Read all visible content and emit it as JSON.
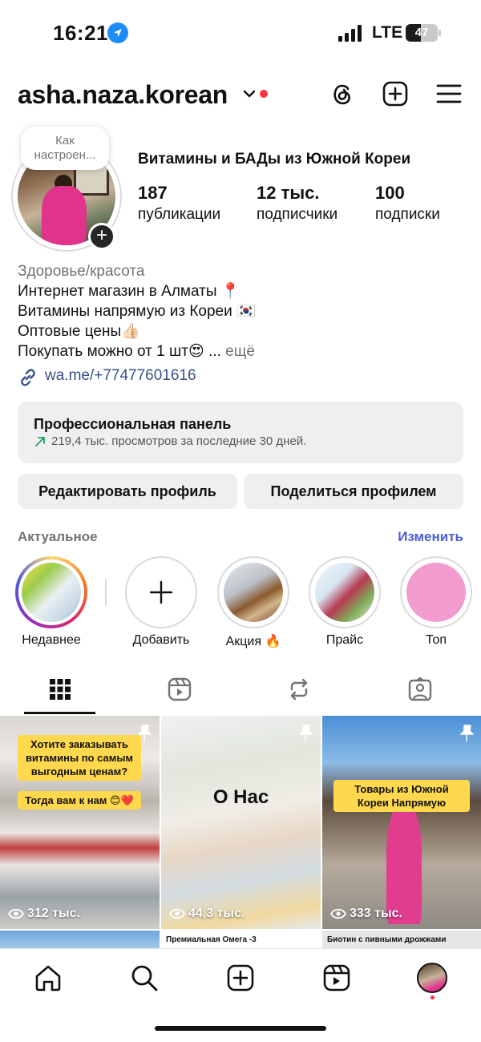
{
  "status_bar": {
    "time": "16:21",
    "network": "LTE",
    "battery": "47",
    "battery_fraction": 0.47
  },
  "header": {
    "username": "asha.naza.korean"
  },
  "profile": {
    "note_line1": "Как",
    "note_line2": "настроен...",
    "display_name": "Витамины и БАДы из Южной Кореи",
    "stats": [
      {
        "value": "187",
        "label": "публикации"
      },
      {
        "value": "12 тыс.",
        "label": "подписчики"
      },
      {
        "value": "100",
        "label": "подписки"
      }
    ]
  },
  "bio": {
    "category": "Здоровье/красота",
    "line1": "Интернет магазин в Алматы 📍",
    "line2": "Витамины напрямую из Кореи 🇰🇷",
    "line3": "Оптовые цены👍🏻",
    "line4": "Покупать можно от 1 шт😍 ...",
    "more": "ещё",
    "link": "wa.me/+77477601616"
  },
  "pro_panel": {
    "title": "Профессиональная панель",
    "subtitle": "219,4 тыс. просмотров за последние 30 дней."
  },
  "buttons": {
    "edit": "Редактировать профиль",
    "share": "Поделиться профилем"
  },
  "highlights": {
    "title": "Актуальное",
    "edit": "Изменить",
    "items": [
      {
        "label": "Недавнее"
      },
      {
        "label": "Добавить"
      },
      {
        "label": "Акция 🔥"
      },
      {
        "label": "Прайс"
      },
      {
        "label": "Топ"
      }
    ]
  },
  "grid": {
    "posts": [
      {
        "views": "312 тыс.",
        "caption1": "Хотите заказывать витамины по самым выгодным ценам?",
        "caption2": "Тогда вам к нам 😊❤️"
      },
      {
        "views": "44,3 тыс.",
        "caption1": "О Нас"
      },
      {
        "views": "333 тыс.",
        "caption1": "Товары из Южной Кореи Напрямую"
      }
    ],
    "row2": [
      {
        "caption": ""
      },
      {
        "caption": "Премиальная Омега -3"
      },
      {
        "caption": "Биотин с пивными дрожжами"
      }
    ]
  }
}
